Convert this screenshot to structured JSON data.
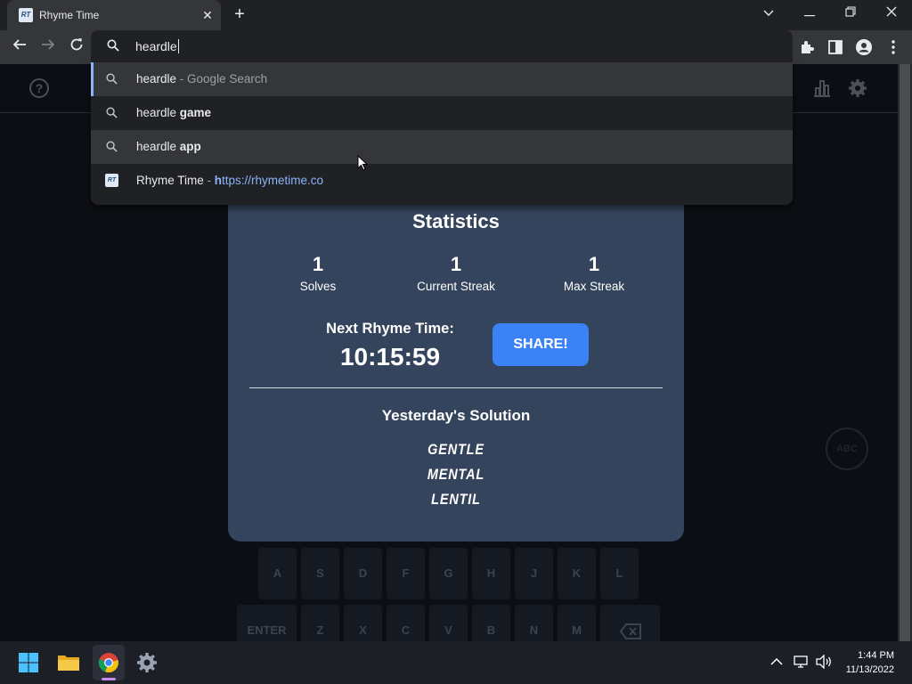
{
  "browser": {
    "tab_title": "Rhyme Time",
    "tab_favicon_text": "RT",
    "omnibox_text": "heardle",
    "suggestions": [
      {
        "query": "heardle",
        "suffix": " - Google Search",
        "bold": ""
      },
      {
        "query": "heardle ",
        "suffix": "",
        "bold": "game"
      },
      {
        "query": "heardle ",
        "suffix": "",
        "bold": "app"
      },
      {
        "query": "Rhyme Time",
        "suffix": " - ",
        "url_bold": "h",
        "url_rest": "ttps://rhymetime.co"
      }
    ]
  },
  "header": {
    "help_icon_text": "?"
  },
  "stats": {
    "title": "Statistics",
    "items": [
      {
        "value": "1",
        "label": "Solves"
      },
      {
        "value": "1",
        "label": "Current Streak"
      },
      {
        "value": "1",
        "label": "Max Streak"
      }
    ],
    "next_label": "Next Rhyme Time:",
    "countdown": "10:15:59",
    "share_label": "SHARE!",
    "yesterday_title": "Yesterday's Solution",
    "solutions": [
      "GENTLE",
      "MENTAL",
      "LENTIL"
    ]
  },
  "abc_button": "ABC",
  "keyboard": {
    "row2": [
      "A",
      "S",
      "D",
      "F",
      "G",
      "H",
      "J",
      "K",
      "L"
    ],
    "row3": [
      "ENTER",
      "Z",
      "X",
      "C",
      "V",
      "B",
      "N",
      "M"
    ]
  },
  "taskbar": {
    "time": "1:44 PM",
    "date": "11/13/2022"
  },
  "colors": {
    "modal_bg": "#34445c",
    "share_button": "#3b82f6",
    "url_link": "#8ab4f8"
  }
}
